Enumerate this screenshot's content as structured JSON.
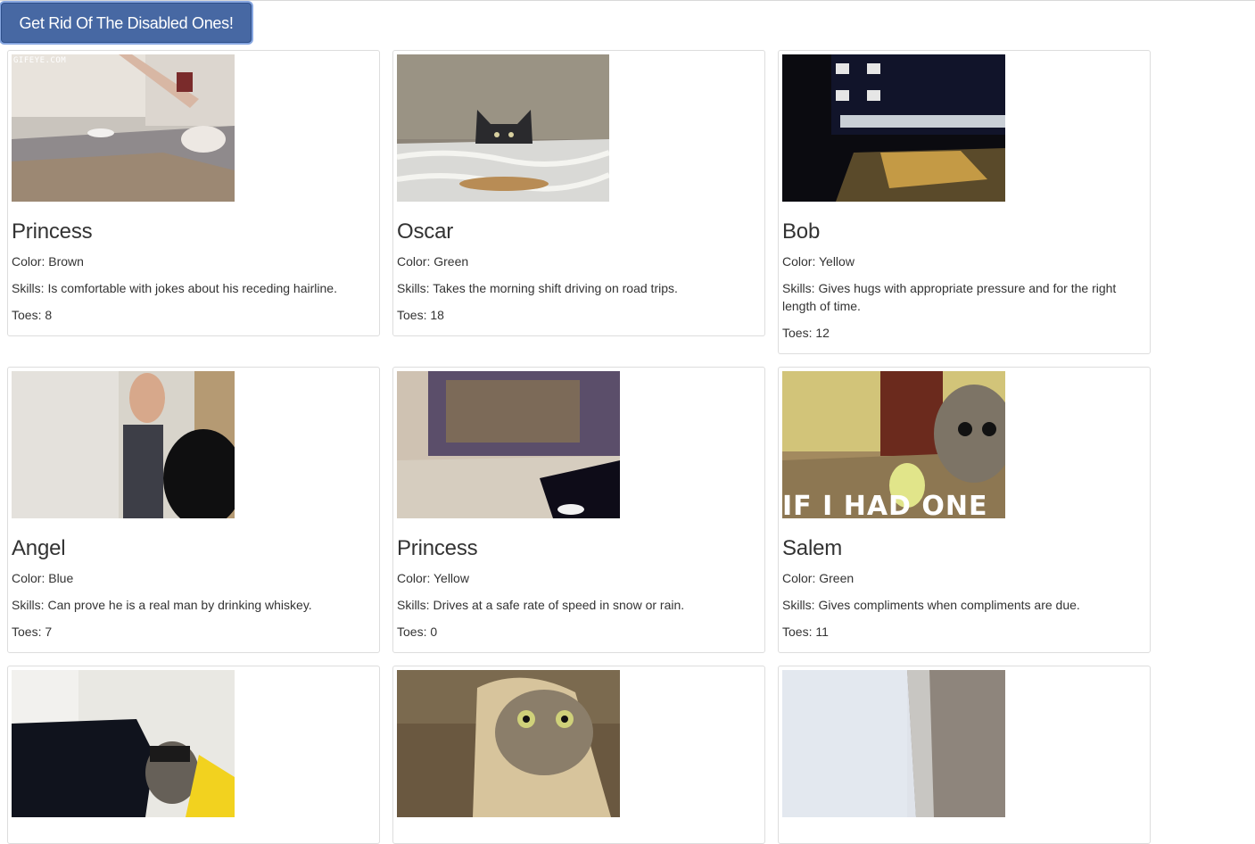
{
  "toolbar": {
    "remove_disabled_label": "Get Rid Of The Disabled Ones!"
  },
  "labels": {
    "color": "Color: ",
    "skills": "Skills: ",
    "toes": "Toes: "
  },
  "cats": [
    {
      "name": "Princess",
      "color": "Brown",
      "skills": "Is comfortable with jokes about his receding hairline.",
      "toes": "8",
      "image_text": "GIFEYE.COM"
    },
    {
      "name": "Oscar",
      "color": "Green",
      "skills": "Takes the morning shift driving on road trips.",
      "toes": "18"
    },
    {
      "name": "Bob",
      "color": "Yellow",
      "skills": "Gives hugs with appropriate pressure and for the right length of time.",
      "toes": "12"
    },
    {
      "name": "Angel",
      "color": "Blue",
      "skills": "Can prove he is a real man by drinking whiskey.",
      "toes": "7"
    },
    {
      "name": "Princess",
      "color": "Yellow",
      "skills": "Drives at a safe rate of speed in snow or rain.",
      "toes": "0"
    },
    {
      "name": "Salem",
      "color": "Green",
      "skills": "Gives compliments when compliments are due.",
      "toes": "11",
      "image_text": "IF I HAD ONE"
    },
    {
      "name": "",
      "color": "",
      "skills": "",
      "toes": ""
    },
    {
      "name": "",
      "color": "",
      "skills": "",
      "toes": ""
    },
    {
      "name": "",
      "color": "",
      "skills": "",
      "toes": ""
    }
  ]
}
